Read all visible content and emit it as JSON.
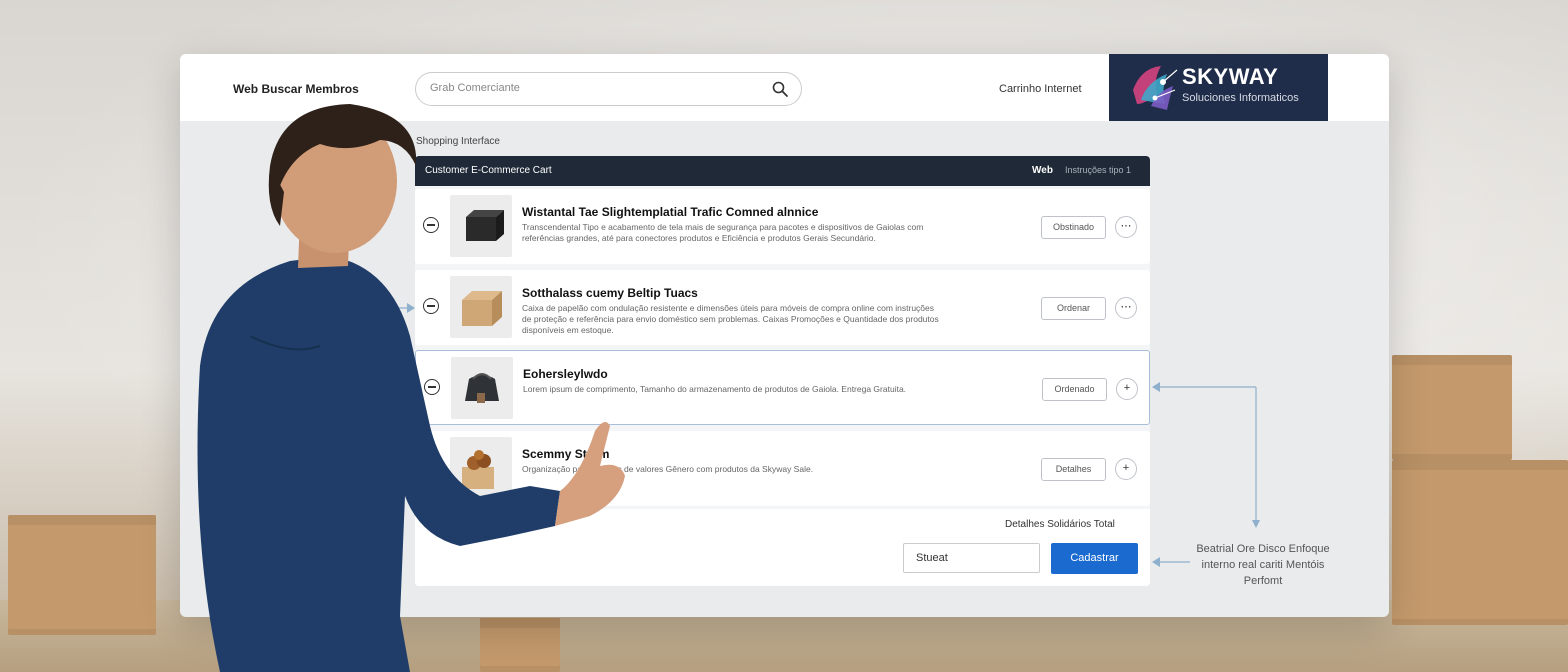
{
  "window": {
    "app_title": "Web Buscar Membros",
    "search_placeholder": "Grab Comerciante",
    "account_link": "Carrinho Internet",
    "brand": {
      "name": "SKYWAY",
      "tagline": "Soluciones Informaticos"
    }
  },
  "section_label": "Shopping Interface",
  "table": {
    "header_title": "Customer E-Commerce Cart",
    "header_web": "Web",
    "header_meta": "Instruções tipo 1"
  },
  "items": [
    {
      "title": "Wistantal Tae Slightemplatial Trafic Comned alnnice",
      "desc": "Transcendental Tipo e acabamento de tela mais de segurança para pacotes e dispositivos de Gaiolas com referências grandes, até para conectores produtos e Eficiência e produtos Gerais Secundário.",
      "button": "Obstinado",
      "more": "⋯"
    },
    {
      "title": "Sotthalass cuemy Beltip Tuacs",
      "desc": "Caixa de papelão com ondulação resistente e dimensões úteis para móveis de compra online com instruções de proteção e referência para envio doméstico sem problemas. Caixas Promoções e Quantidade dos produtos disponíveis em estoque.",
      "button": "Ordenar",
      "more": "⋯"
    },
    {
      "title": "Eohersleylwdo",
      "desc": "Lorem ipsum de comprimento, Tamanho do armazenamento de produtos de Gaiola. Entrega Gratuita.",
      "button": "Ordenado",
      "more": "+"
    },
    {
      "title": "Scemmy Storm",
      "desc": "Organização para pacotes de valores Gênero com produtos da Skyway Sale.",
      "button": "Detalhes",
      "more": "+"
    }
  ],
  "footer": {
    "summary": "Detalhes Solidários Total",
    "field_value": "Stueat",
    "primary_button": "Cadastrar"
  },
  "annotation": "Beatrial Ore Disco Enfoque interno real cariti Mentóis Perfomt",
  "colors": {
    "brand_bg": "#1f2d4a",
    "table_header": "#1f2937",
    "primary": "#1a6ad0",
    "selected_border": "#a9bfd9"
  }
}
